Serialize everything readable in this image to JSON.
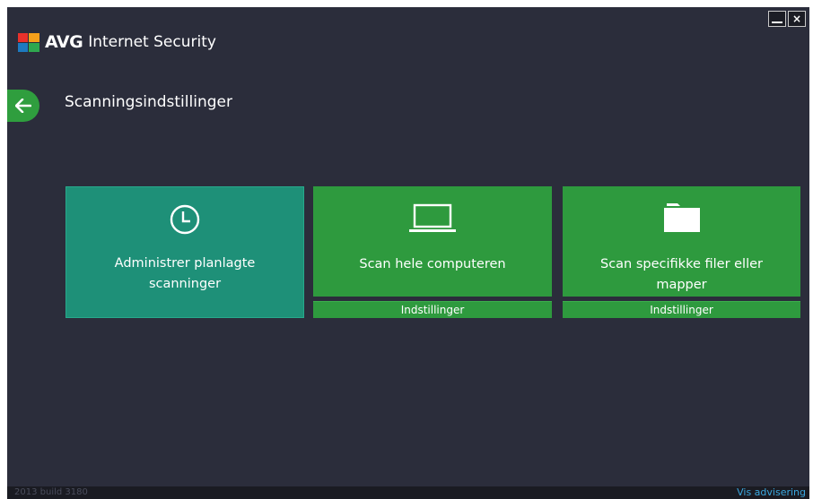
{
  "window": {
    "brand": "AVG",
    "product": "Internet Security",
    "controls": {
      "minimize": "minimize",
      "close": "×"
    }
  },
  "page": {
    "title": "Scanningsindstillinger"
  },
  "tiles": [
    {
      "label_line1": "Administrer planlagte",
      "label_line2": "scanninger",
      "icon": "clock-icon"
    },
    {
      "label_line1": "Scan hele computeren",
      "label_line2": "",
      "icon": "laptop-icon",
      "settings_label": "Indstillinger"
    },
    {
      "label_line1": "Scan specifikke filer eller",
      "label_line2": "mapper",
      "icon": "folder-icon",
      "settings_label": "Indstillinger"
    }
  ],
  "statusbar": {
    "build": "2013  build 3180",
    "notify_link": "Vis advisering"
  },
  "colors": {
    "background": "#2b2d3b",
    "teal_tile": "#1e9078",
    "green_tile": "#2e9a3e",
    "link": "#3aa8e0"
  }
}
